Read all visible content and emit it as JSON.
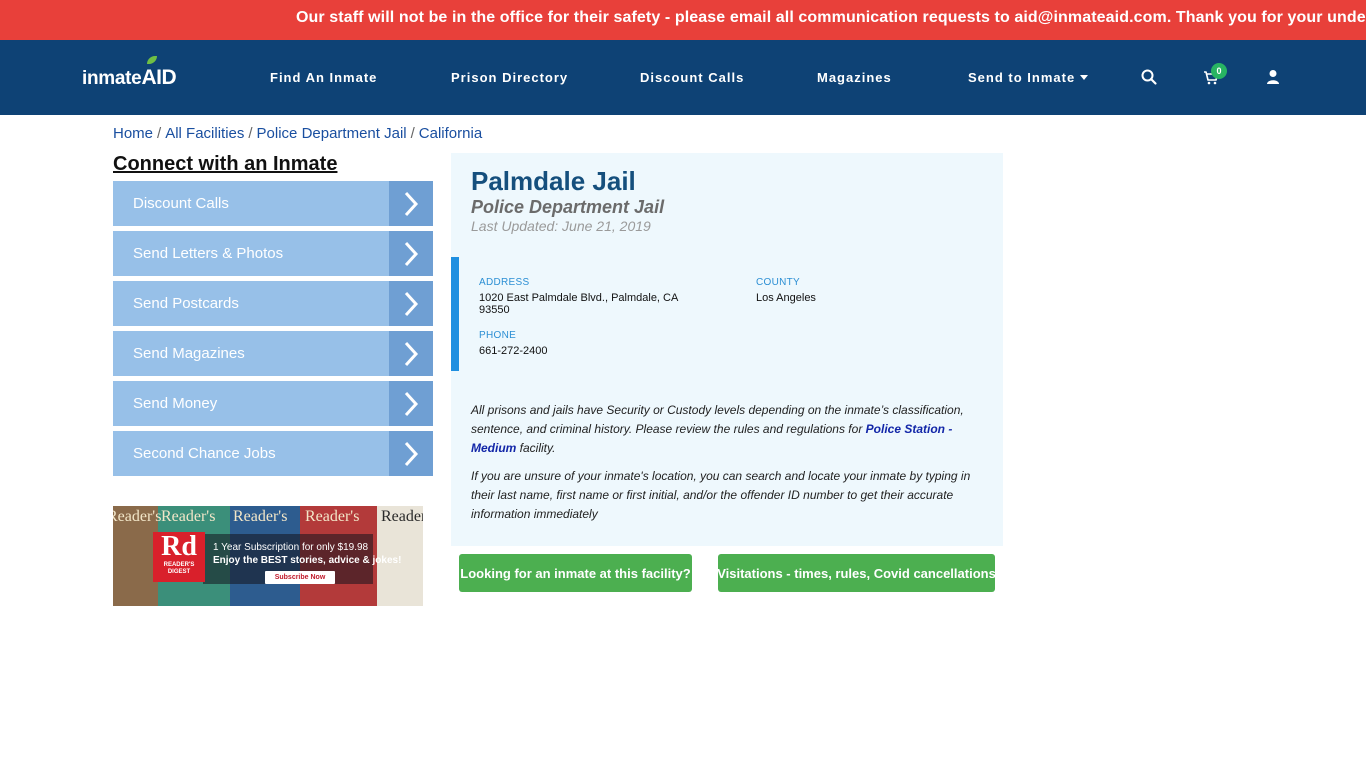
{
  "alert": {
    "text": "Our staff will not be in the office for their safety - please email all communication requests to aid@inmateaid.com. Thank you for your unders"
  },
  "nav": {
    "logo_part1": "inmate",
    "logo_part2": "AID",
    "links": [
      "Find An Inmate",
      "Prison Directory",
      "Discount Calls",
      "Magazines",
      "Send to Inmate"
    ],
    "cart_count": "0",
    "icons": [
      "search-icon",
      "cart-icon",
      "user-icon"
    ]
  },
  "breadcrumb": {
    "items": [
      "Home",
      "All Facilities",
      "Police Department Jail",
      "California"
    ],
    "separator": "/"
  },
  "sidebar": {
    "title": "Connect with an Inmate",
    "buttons": [
      "Discount Calls",
      "Send Letters & Photos",
      "Send Postcards",
      "Send Magazines",
      "Send Money",
      "Second Chance Jobs"
    ]
  },
  "ad": {
    "brand_short": "Rd",
    "brand_sub1": "READER'S",
    "brand_sub2": "DIGEST",
    "promo_line1": "1 Year Subscription for only $19.98",
    "promo_line2": "Enjoy the BEST stories, advice & jokes!",
    "cta": "Subscribe Now",
    "cover_text": "Reader's"
  },
  "facility": {
    "name": "Palmdale Jail",
    "type": "Police Department Jail",
    "updated": "Last Updated: June 21, 2019",
    "address_label": "ADDRESS",
    "address_line1": "1020 East Palmdale Blvd., Palmdale, CA",
    "address_line2": "93550",
    "county_label": "COUNTY",
    "county": "Los Angeles",
    "phone_label": "PHONE",
    "phone": "661-272-2400",
    "para1_start": "All prisons and jails have Security or Custody levels depending on the inmate’s classification, sentence, and criminal history. Please review the rules and regulations for ",
    "para1_link": "Police Station - Medium",
    "para1_end": " facility.",
    "para2": "If you are unsure of your inmate's location, you can search and locate your inmate by typing in their last name, first name or first initial, and/or the offender ID number to get their accurate information immediately"
  },
  "actions": {
    "btn1": "Looking for an inmate at this facility?",
    "btn2": "Visitations - times, rules, Covid cancellations"
  },
  "colors": {
    "alert_bg": "#e8403a",
    "nav_bg": "#0e4275",
    "side_btn": "#97c0e8",
    "side_arrow": "#6f9fd3",
    "panel_bg": "#eef8fd",
    "accent_bar": "#1f8fe0",
    "green": "#4caf50"
  }
}
